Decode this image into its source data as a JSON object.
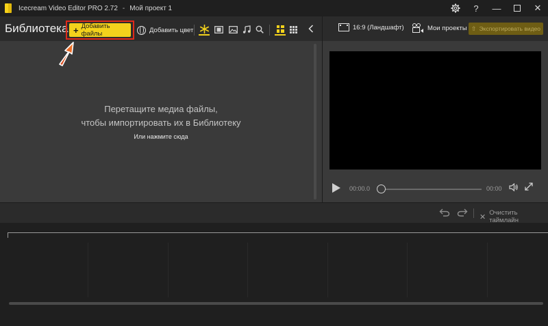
{
  "window": {
    "app_title": "Icecream Video Editor PRO 2.72",
    "separator": "-",
    "project_title": "Мой проект 1",
    "icons": [
      "gear-icon",
      "help-icon",
      "minimize-icon",
      "maximize-icon",
      "close-icon"
    ],
    "help_glyph": "?",
    "minimize_glyph": "—",
    "close_glyph": "✕"
  },
  "library": {
    "title": "Библиотека",
    "add_files_label": "Добавить файлы",
    "add_color_label": "Добавить цвет",
    "filters": [
      "all-icon",
      "video-icon",
      "image-icon",
      "audio-icon",
      "search-icon"
    ],
    "active_filter": "all",
    "view_modes": [
      "large-grid-icon",
      "small-grid-icon"
    ],
    "active_view": "large-grid",
    "drop_hint_line1": "Перетащите медиа файлы,",
    "drop_hint_line2": "чтобы импортировать их в Библиотеку",
    "drop_click": "Или нажмите сюда"
  },
  "preview": {
    "aspect_ratio_label": "16:9 (Ландшафт)",
    "my_projects_label": "Мои проекты",
    "export_label": "Экспортировать видео",
    "time_current": "00:00.0",
    "time_total": "00:00",
    "progress": 0
  },
  "timeline": {
    "clear_label": "Очистить таймлайн"
  },
  "colors": {
    "accent": "#f3d21c",
    "highlight": "#e12a1a",
    "panel": "#3a3a3a",
    "background": "#2b2b2b"
  }
}
